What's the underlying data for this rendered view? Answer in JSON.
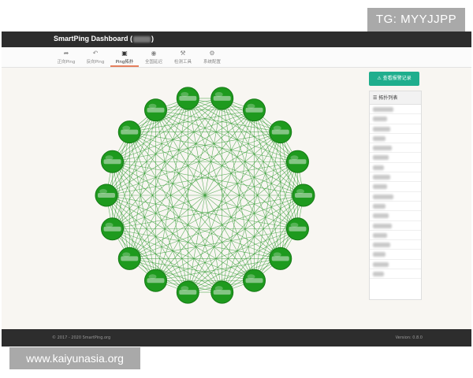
{
  "watermark_top": "TG: MYYJJPP",
  "watermark_bottom": "www.kaiyunasia.org",
  "navbar": {
    "brand_prefix": "SmartPing Dashboard (",
    "brand_suffix": ")"
  },
  "tabs": [
    {
      "label": "正向Ping",
      "icon": "share-icon"
    },
    {
      "label": "反向Ping",
      "icon": "reply-icon"
    },
    {
      "label": "Ping拓扑",
      "icon": "image-icon",
      "active": true
    },
    {
      "label": "全国延迟",
      "icon": "map-marker-icon"
    },
    {
      "label": "检测工具",
      "icon": "wrench-icon"
    },
    {
      "label": "系统配置",
      "icon": "gear-icon"
    }
  ],
  "alarm_button": {
    "label": "查看报警记录",
    "icon": "warning-icon"
  },
  "topology_list": {
    "title": "拓扑列表",
    "icon": "list-icon",
    "row_count": 18
  },
  "topology": {
    "node_count": 18,
    "node_color": "#1e9a1e",
    "link_color": "#2f9a2f"
  },
  "footer": {
    "copyright": "© 2017 - 2020 SmartPing.org",
    "version": "Version: 0.8.0"
  },
  "colors": {
    "navbar": "#2d2d2d",
    "accent": "#1fae8d",
    "active_tab": "#e57f5d"
  }
}
